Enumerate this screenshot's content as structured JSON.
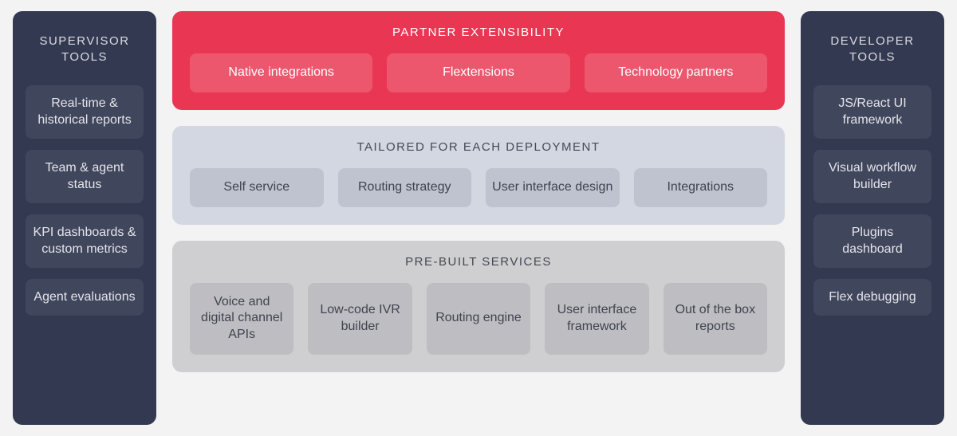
{
  "left": {
    "title": "SUPERVISOR\nTOOLS",
    "items": [
      "Real-time & historical reports",
      "Team & agent status",
      "KPI dashboards & custom metrics",
      "Agent evaluations"
    ]
  },
  "right": {
    "title": "DEVELOPER\nTOOLS",
    "items": [
      "JS/React UI framework",
      "Visual workflow builder",
      "Plugins dashboard",
      "Flex debugging"
    ]
  },
  "center": {
    "panels": [
      {
        "title": "PARTNER EXTENSIBILITY",
        "chips": [
          "Native integrations",
          "Flextensions",
          "Technology partners"
        ]
      },
      {
        "title": "TAILORED FOR EACH DEPLOYMENT",
        "chips": [
          "Self service",
          "Routing strategy",
          "User interface design",
          "Integrations"
        ]
      },
      {
        "title": "PRE-BUILT SERVICES",
        "chips": [
          "Voice and digital channel APIs",
          "Low-code IVR builder",
          "Routing engine",
          "User interface framework",
          "Out of the box reports"
        ]
      }
    ]
  }
}
